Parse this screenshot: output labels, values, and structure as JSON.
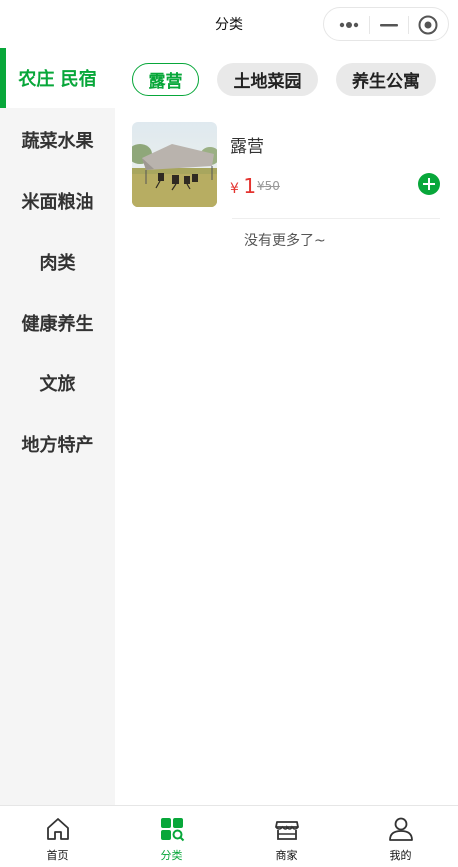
{
  "header": {
    "title": "分类"
  },
  "sidebar": {
    "items": [
      {
        "label": "农庄 民宿"
      },
      {
        "label": "蔬菜水果"
      },
      {
        "label": "米面粮油"
      },
      {
        "label": "肉类"
      },
      {
        "label": "健康养生"
      },
      {
        "label": "文旅"
      },
      {
        "label": "地方特产"
      }
    ]
  },
  "tabs": [
    {
      "label": "露营"
    },
    {
      "label": "土地菜园"
    },
    {
      "label": "养生公寓"
    }
  ],
  "product": {
    "name": "露营",
    "currency": "¥",
    "price": "1",
    "original_price": "¥50"
  },
  "list_end_text": "没有更多了~",
  "tabbar": {
    "items": [
      {
        "label": "首页"
      },
      {
        "label": "分类"
      },
      {
        "label": "商家"
      },
      {
        "label": "我的"
      }
    ]
  },
  "colors": {
    "accent": "#08a73a",
    "price": "#e4332f"
  }
}
